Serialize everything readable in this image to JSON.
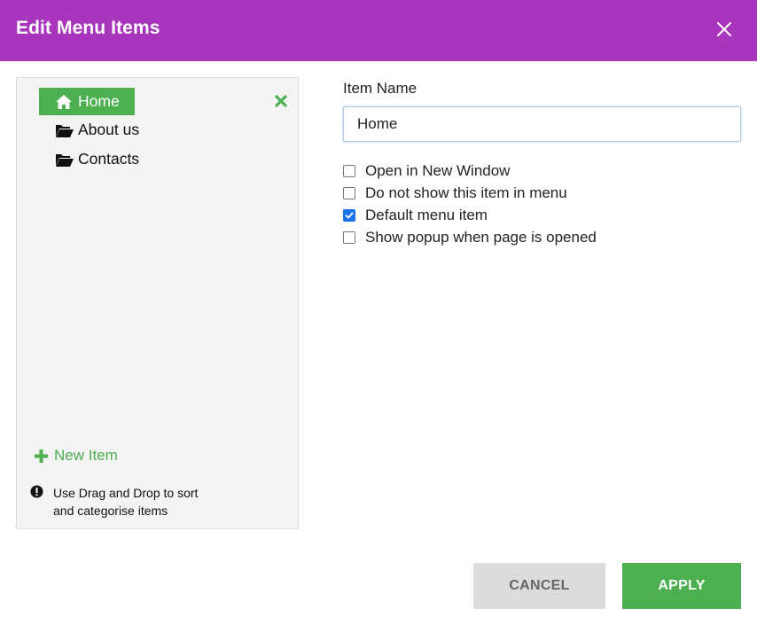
{
  "dialog": {
    "title": "Edit Menu Items",
    "close_icon": "close-icon"
  },
  "menu_tree": {
    "items": [
      {
        "label": "Home",
        "icon": "home-icon",
        "active": true
      },
      {
        "label": "About us",
        "icon": "folder-open-icon",
        "active": false
      },
      {
        "label": "Contacts",
        "icon": "folder-open-icon",
        "active": false
      }
    ],
    "remove_icon": "remove-icon",
    "new_item_label": "New Item",
    "hint_line1": "Use Drag and Drop to sort",
    "hint_line2": "and categorise items"
  },
  "form": {
    "item_name_label": "Item Name",
    "item_name_value": "Home",
    "options": [
      {
        "label": "Open in New Window",
        "checked": false
      },
      {
        "label": "Do not show this item in menu",
        "checked": false
      },
      {
        "label": "Default menu item",
        "checked": true
      },
      {
        "label": "Show popup when page is opened",
        "checked": false
      }
    ]
  },
  "buttons": {
    "cancel_label": "CANCEL",
    "apply_label": "APPLY"
  },
  "colors": {
    "header": "#a836bd",
    "accent_green": "#4caf50",
    "checkbox_blue": "#1a73e8"
  }
}
